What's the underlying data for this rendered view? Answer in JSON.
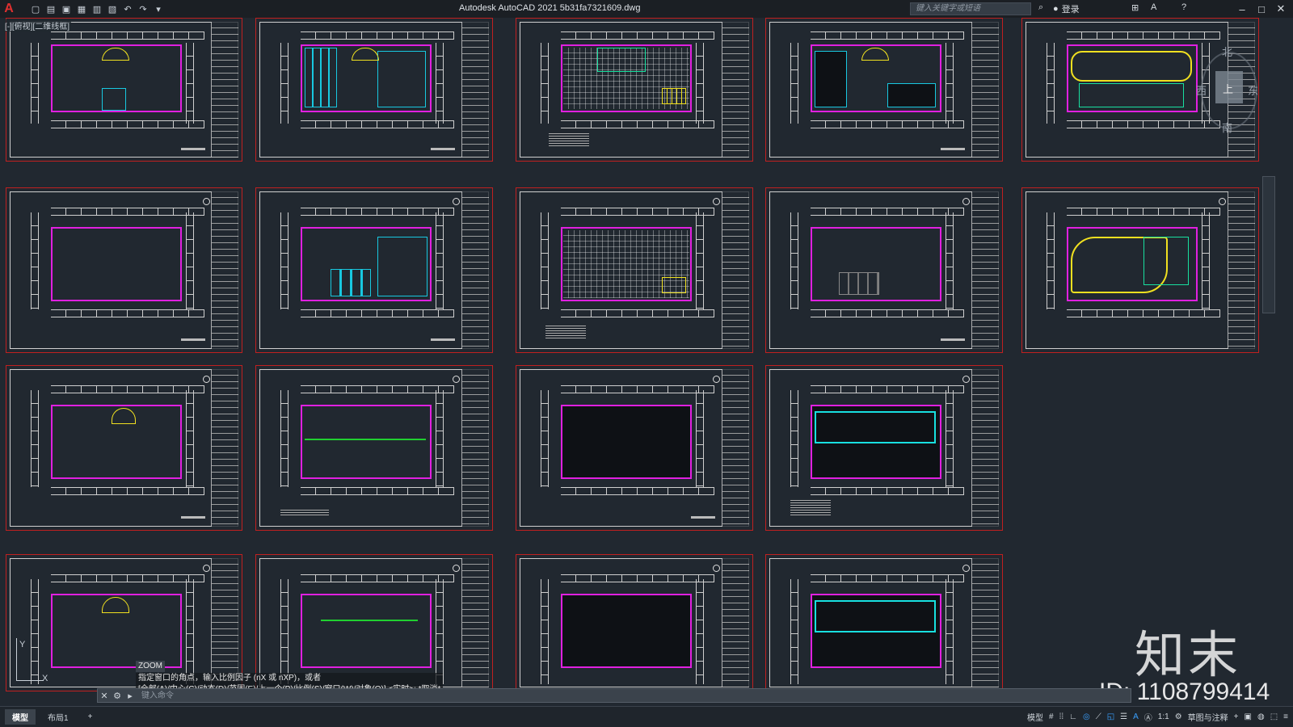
{
  "titlebar": {
    "app_icon": "A",
    "title": "Autodesk AutoCAD 2021    5b31fa7321609.dwg",
    "search_placeholder": "键入关键字或短语",
    "login_label": "登录",
    "icons": [
      "new-icon",
      "open-icon",
      "save-icon",
      "saveas-icon",
      "publish-icon",
      "plot-icon",
      "undo-icon",
      "redo-icon",
      "more-icon"
    ]
  },
  "viewport": {
    "label": "[-][俯视][二维线框]"
  },
  "viewcube": {
    "north": "北",
    "west": "西",
    "east": "东",
    "south": "南",
    "top": "上"
  },
  "watermark": {
    "brand": "知末",
    "id": "ID: 1108799414"
  },
  "ucs": {
    "x": "X",
    "y": "Y"
  },
  "command": {
    "zoom_tag": "ZOOM",
    "prompt_line1": "指定窗口的角点，输入比例因子 (nX 或 nXP)，或者",
    "prompt_line2": "[全部(A)/中心(C)/动态(D)/范围(E)/上一个(P)/比例(S)/窗口(W)/对象(O)] <实时>: *取消*",
    "input_placeholder": "键入命令"
  },
  "statusbar": {
    "tabs": [
      "模型",
      "布局1"
    ],
    "add_tab": "+",
    "model_label": "模型",
    "scale": "1:1",
    "workspace": "草图与注释"
  }
}
